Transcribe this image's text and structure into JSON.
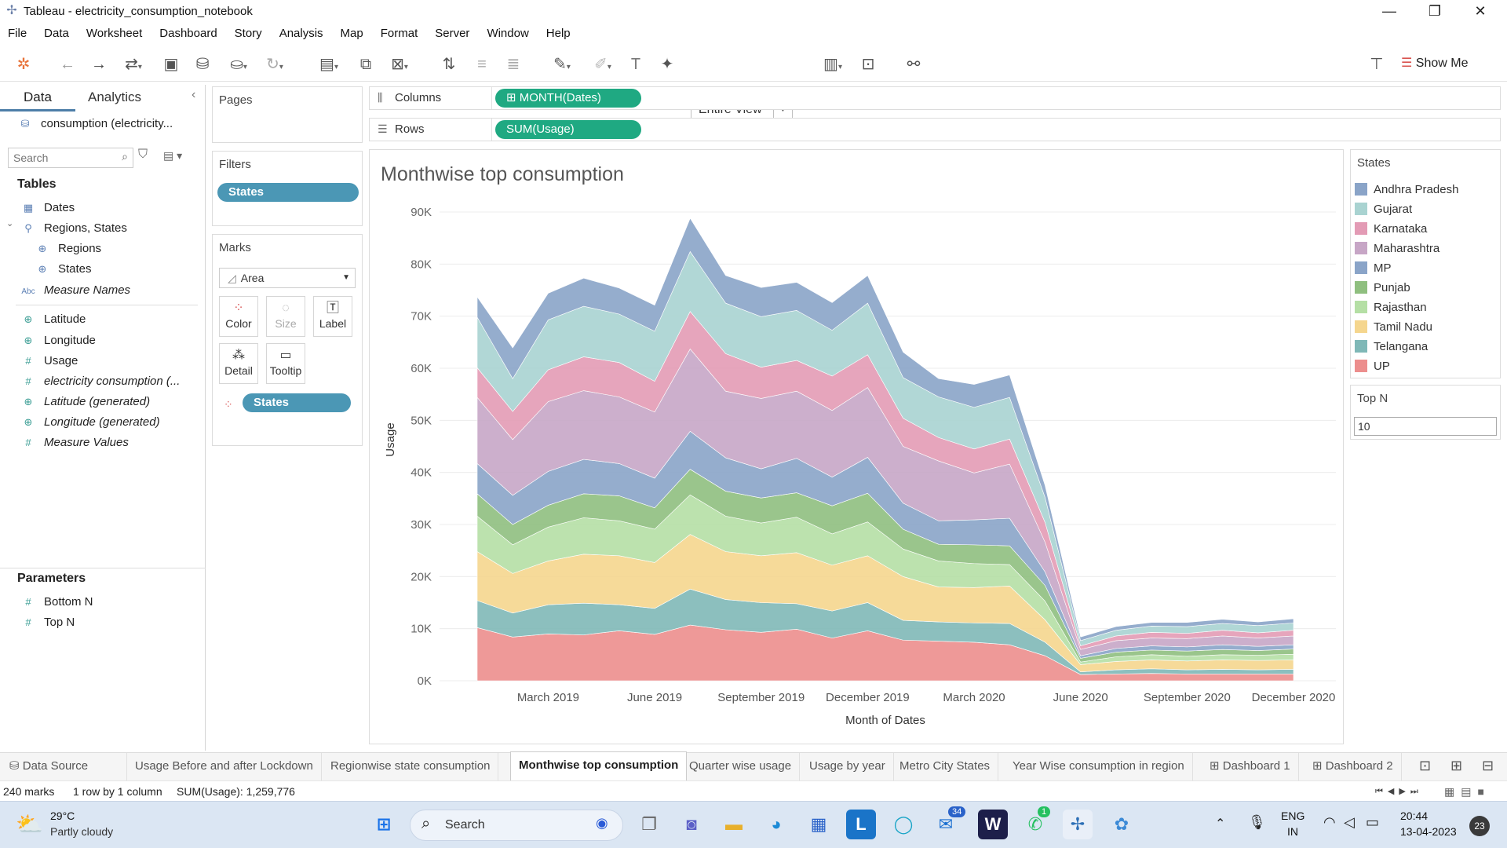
{
  "window": {
    "title": "Tableau - electricity_consumption_notebook",
    "min": "—",
    "max": "❐",
    "close": "✕"
  },
  "menu": [
    "File",
    "Data",
    "Worksheet",
    "Dashboard",
    "Story",
    "Analysis",
    "Map",
    "Format",
    "Server",
    "Window",
    "Help"
  ],
  "toolbar": {
    "fit": "Entire View",
    "show_me": "Show Me"
  },
  "datapane": {
    "tab_data": "Data",
    "tab_analytics": "Analytics",
    "datasource": "consumption (electricity...",
    "search_placeholder": "Search",
    "tables_header": "Tables",
    "fields": [
      {
        "label": "Dates",
        "icon": "calendar-icon"
      },
      {
        "label": "Regions, States",
        "icon": "hierarchy-icon"
      },
      {
        "label": "Regions",
        "icon": "globe-icon"
      },
      {
        "label": "States",
        "icon": "globe-icon"
      },
      {
        "label": "Measure Names",
        "icon": "abc-icon"
      },
      {
        "label": "Latitude",
        "icon": "globe-icon"
      },
      {
        "label": "Longitude",
        "icon": "globe-icon"
      },
      {
        "label": "Usage",
        "icon": "hash-icon"
      },
      {
        "label": "electricity consumption (...",
        "icon": "hash-icon"
      },
      {
        "label": "Latitude (generated)",
        "icon": "globe-icon"
      },
      {
        "label": "Longitude (generated)",
        "icon": "globe-icon"
      },
      {
        "label": "Measure Values",
        "icon": "hash-icon"
      }
    ],
    "params_header": "Parameters",
    "params": [
      "Bottom N",
      "Top N"
    ]
  },
  "shelves": {
    "pages": "Pages",
    "filters": "Filters",
    "filter_pill": "States",
    "marks": "Marks",
    "mark_type": "Area",
    "mark_buttons": [
      "Color",
      "Size",
      "Label",
      "Detail",
      "Tooltip"
    ],
    "marks_pill": "States",
    "columns_label": "Columns",
    "columns_pill": "MONTH(Dates)",
    "rows_label": "Rows",
    "rows_pill": "SUM(Usage)"
  },
  "legend": {
    "title": "States",
    "items": [
      {
        "name": "Andhra Pradesh",
        "color": "#8aa4c8"
      },
      {
        "name": "Gujarat",
        "color": "#a9d3d1"
      },
      {
        "name": "Karnataka",
        "color": "#e39bb5"
      },
      {
        "name": "Maharashtra",
        "color": "#c7a6c6"
      },
      {
        "name": "MP",
        "color": "#8aa4c8"
      },
      {
        "name": "Punjab",
        "color": "#8fbf7f"
      },
      {
        "name": "Rajasthan",
        "color": "#b5dfa5"
      },
      {
        "name": "Tamil Nadu",
        "color": "#f5d68e"
      },
      {
        "name": "Telangana",
        "color": "#7fb8b7"
      },
      {
        "name": "UP",
        "color": "#ec8e8d"
      }
    ]
  },
  "topn": {
    "title": "Top N",
    "value": "10"
  },
  "chart_data": {
    "type": "area",
    "title": "Monthwise top consumption",
    "xlabel": "Month of Dates",
    "ylabel": "Usage",
    "ylim": [
      0,
      90000
    ],
    "yticks": [
      "0K",
      "10K",
      "20K",
      "30K",
      "40K",
      "50K",
      "60K",
      "70K",
      "80K",
      "90K"
    ],
    "xticks": [
      {
        "label": "March 2019",
        "i": 2
      },
      {
        "label": "June 2019",
        "i": 5
      },
      {
        "label": "September 2019",
        "i": 8
      },
      {
        "label": "December 2019",
        "i": 11
      },
      {
        "label": "March 2020",
        "i": 14
      },
      {
        "label": "June 2020",
        "i": 17
      },
      {
        "label": "September 2020",
        "i": 20
      },
      {
        "label": "December 2020",
        "i": 23
      }
    ],
    "x": [
      "Jan 2019",
      "Feb 2019",
      "Mar 2019",
      "Apr 2019",
      "May 2019",
      "Jun 2019",
      "Jul 2019",
      "Aug 2019",
      "Sep 2019",
      "Oct 2019",
      "Nov 2019",
      "Dec 2019",
      "Jan 2020",
      "Feb 2020",
      "Mar 2020",
      "Apr 2020",
      "May 2020",
      "Jun 2020",
      "Jul 2020",
      "Aug 2020",
      "Sep 2020",
      "Oct 2020",
      "Nov 2020",
      "Dec 2020"
    ],
    "stack_order_bottom_to_top": [
      "UP",
      "Telangana",
      "Tamil Nadu",
      "Rajasthan",
      "Punjab",
      "MP",
      "Maharashtra",
      "Karnataka",
      "Gujarat",
      "Andhra Pradesh"
    ],
    "series": [
      {
        "name": "UP",
        "values": [
          10200,
          8400,
          9000,
          8800,
          9600,
          8900,
          10700,
          9800,
          9300,
          9900,
          8200,
          9600,
          7800,
          7600,
          7400,
          6900,
          4800,
          1200,
          1300,
          1400,
          1300,
          1300,
          1300,
          1300
        ]
      },
      {
        "name": "Telangana",
        "values": [
          5200,
          4600,
          5600,
          6100,
          5000,
          5000,
          6900,
          5800,
          5700,
          4900,
          5200,
          5400,
          3800,
          3700,
          3700,
          4100,
          2600,
          500,
          800,
          900,
          800,
          900,
          800,
          900
        ]
      },
      {
        "name": "Tamil Nadu",
        "values": [
          9400,
          7600,
          8400,
          9400,
          9400,
          8800,
          10500,
          9200,
          9000,
          9800,
          8800,
          9000,
          8400,
          6700,
          6800,
          7200,
          4300,
          1400,
          1600,
          1700,
          1700,
          1800,
          1800,
          1800
        ]
      },
      {
        "name": "Rajasthan",
        "values": [
          6800,
          5500,
          6500,
          7000,
          6700,
          6400,
          7600,
          6800,
          6300,
          6800,
          6000,
          6500,
          5300,
          5000,
          4600,
          4100,
          3600,
          500,
          900,
          1000,
          900,
          1000,
          1000,
          1100
        ]
      },
      {
        "name": "Punjab",
        "values": [
          4300,
          3900,
          4200,
          4600,
          4800,
          4100,
          4900,
          4800,
          4800,
          4700,
          5400,
          5500,
          3800,
          3200,
          3600,
          3600,
          3000,
          700,
          900,
          900,
          1000,
          1000,
          900,
          1000
        ]
      },
      {
        "name": "MP",
        "values": [
          5800,
          5600,
          6500,
          6600,
          6200,
          5700,
          7300,
          6400,
          5600,
          6600,
          5500,
          6900,
          5000,
          4500,
          4800,
          5300,
          2600,
          500,
          700,
          800,
          800,
          900,
          800,
          800
        ]
      },
      {
        "name": "Maharashtra",
        "values": [
          12700,
          10700,
          13400,
          13200,
          12800,
          12700,
          15800,
          12800,
          13500,
          12900,
          12800,
          13400,
          10900,
          11500,
          9000,
          10400,
          5700,
          1200,
          1500,
          1500,
          1600,
          1700,
          1600,
          1700
        ]
      },
      {
        "name": "Karnataka",
        "values": [
          5700,
          5400,
          6100,
          6500,
          6600,
          5900,
          7200,
          7200,
          6000,
          5900,
          6600,
          6300,
          5400,
          4500,
          4600,
          4800,
          3800,
          700,
          900,
          1100,
          1000,
          1100,
          1000,
          1100
        ]
      },
      {
        "name": "Gujarat",
        "values": [
          9700,
          6300,
          9600,
          9700,
          9300,
          9600,
          11500,
          9700,
          9700,
          9600,
          8800,
          9900,
          7800,
          7800,
          8000,
          8000,
          4800,
          1000,
          1100,
          1200,
          1300,
          1300,
          1400,
          1400
        ]
      },
      {
        "name": "Andhra Pradesh",
        "values": [
          3900,
          5900,
          5100,
          5400,
          5000,
          5000,
          6400,
          5300,
          5600,
          5400,
          5300,
          5300,
          4900,
          3500,
          4400,
          4300,
          2300,
          700,
          700,
          700,
          800,
          800,
          700,
          800
        ]
      }
    ]
  },
  "sheets": {
    "data_source": "Data Source",
    "tabs": [
      "Usage Before and after Lockdown",
      "Regionwise state consumption",
      "Monthwise top consumption",
      "Quarter wise usage",
      "Usage by year",
      "Metro City States",
      "Year Wise consumption in region",
      "Dashboard 1",
      "Dashboard 2"
    ]
  },
  "status": {
    "marks": "240 marks",
    "dims": "1 row by 1 column",
    "sum": "SUM(Usage): 1,259,776"
  },
  "taskbar": {
    "weather_temp": "29°C",
    "weather_desc": "Partly cloudy",
    "search": "Search",
    "lang1": "ENG",
    "lang2": "IN",
    "time": "20:44",
    "date": "13-04-2023",
    "notif": "23",
    "badge_mail": "34",
    "badge_whatsapp": "1"
  }
}
